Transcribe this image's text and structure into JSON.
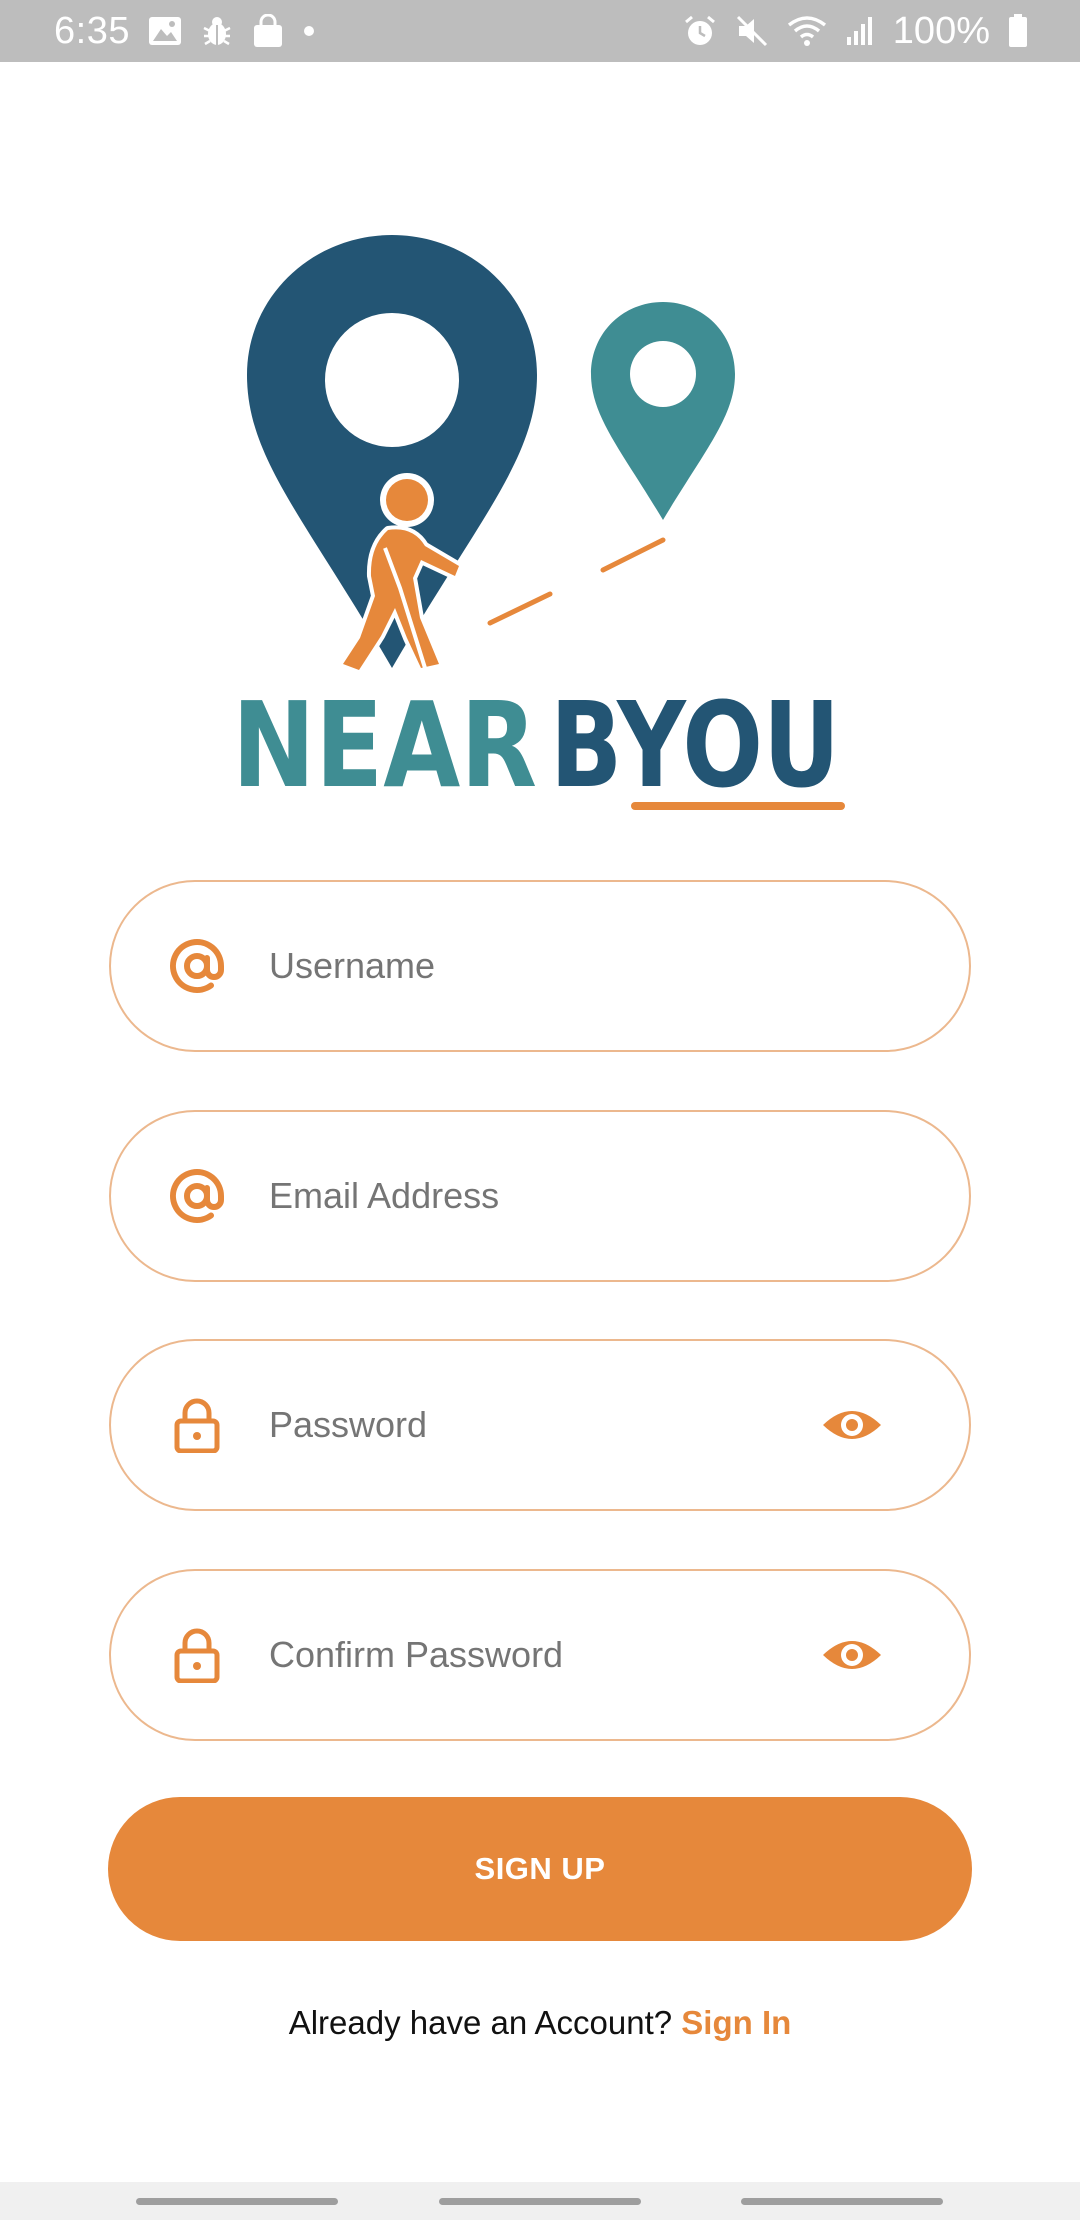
{
  "status_bar": {
    "time": "6:35",
    "battery": "100%",
    "icons_left": [
      "image-icon",
      "bug-icon",
      "shopping-bag-icon",
      "dot-icon"
    ],
    "icons_right": [
      "alarm-icon",
      "mute-icon",
      "wifi-icon",
      "signal-icon",
      "battery-icon"
    ]
  },
  "logo": {
    "text_left": "NEAR",
    "text_right": "BYOU",
    "colors": {
      "dark_blue": "#235574",
      "teal": "#3f8d93",
      "orange": "#e6883b"
    }
  },
  "form": {
    "username": {
      "placeholder": "Username",
      "value": "",
      "icon": "at-icon"
    },
    "email": {
      "placeholder": "Email Address",
      "value": "",
      "icon": "at-icon"
    },
    "password": {
      "placeholder": "Password",
      "value": "",
      "icon": "lock-icon",
      "toggle_icon": "eye-icon"
    },
    "confirm_password": {
      "placeholder": "Confirm Password",
      "value": "",
      "icon": "lock-icon",
      "toggle_icon": "eye-icon"
    }
  },
  "signup_button": {
    "label": "SIGN UP"
  },
  "account_prompt": {
    "text": "Already have an Account?",
    "link": "Sign In"
  },
  "colors": {
    "accent": "#e6883b",
    "field_border": "#ecb88e",
    "status_bar": "#bdbdbd"
  }
}
